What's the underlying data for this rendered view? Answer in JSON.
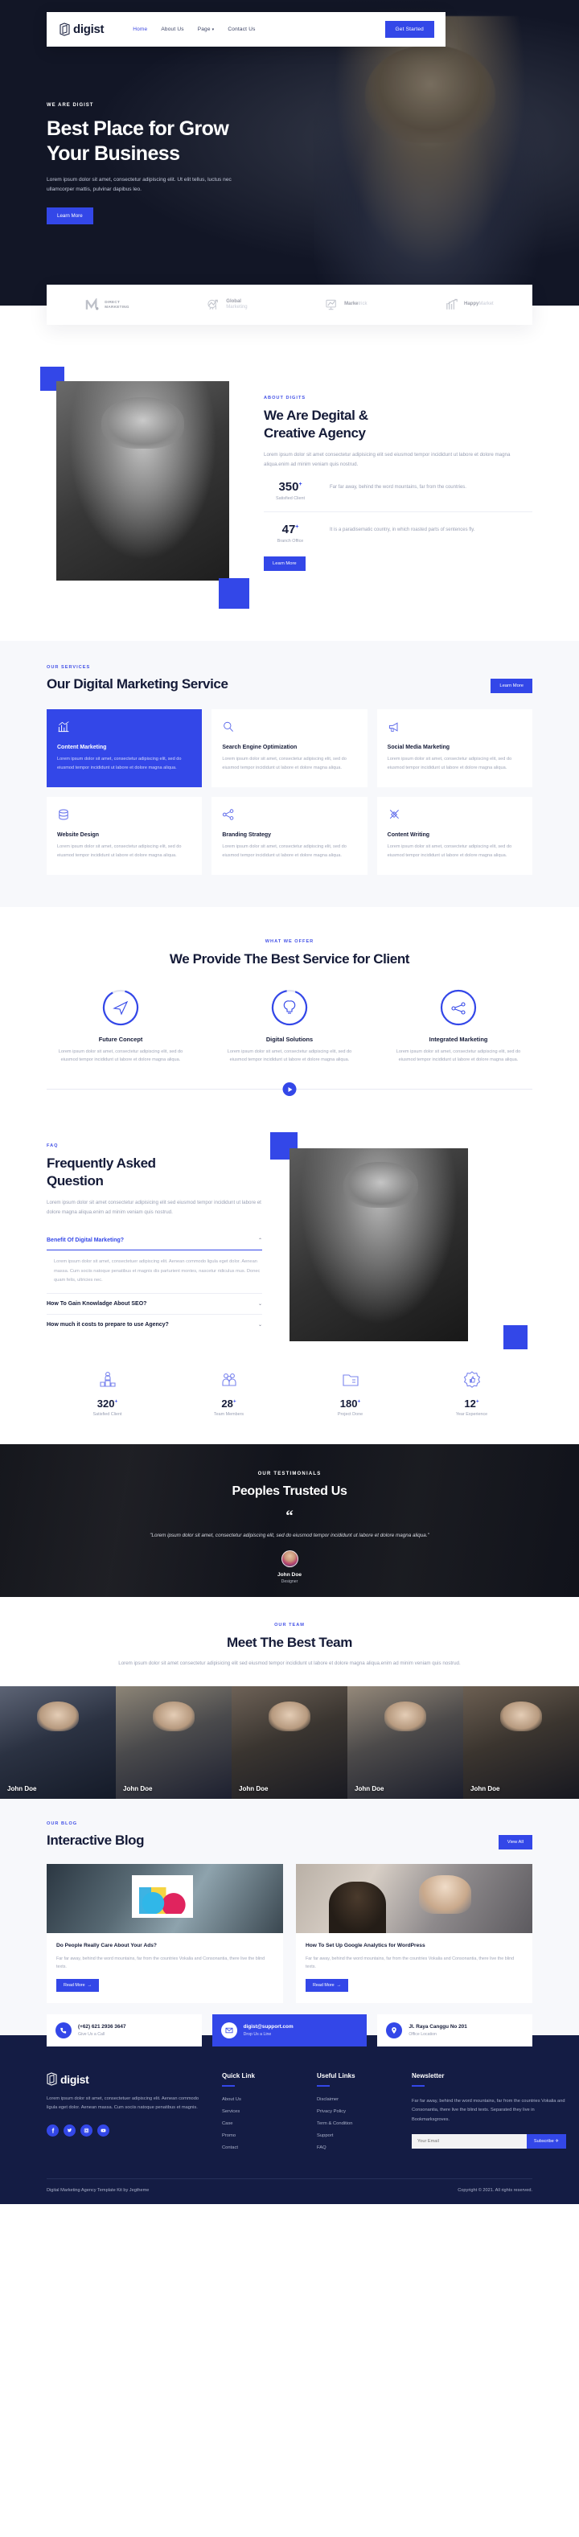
{
  "brand": {
    "name": "digist",
    "logo_icon": "digist-logo-icon"
  },
  "nav": {
    "items": [
      {
        "label": "Home",
        "active": true
      },
      {
        "label": "About Us",
        "active": false
      },
      {
        "label": "Page",
        "active": false,
        "has_caret": true
      },
      {
        "label": "Contact Us",
        "active": false
      }
    ],
    "cta_label": "Get Started"
  },
  "hero": {
    "eyebrow": "WE ARE DIGIST",
    "title_line1": "Best Place for Grow",
    "title_line2": "Your Business",
    "description": "Lorem ipsum dolor sit amet, consectetur adipiscing elit. Ut elit tellus, luctus nec ullamcorper mattis, pulvinar dapibus leo.",
    "cta_label": "Learn More"
  },
  "logos": [
    {
      "name": "DIRECT",
      "name2": "MARKETING",
      "icon": "direct-marketing-logo-icon"
    },
    {
      "name": "Global",
      "name2": "Marketing",
      "icon": "global-marketing-logo-icon"
    },
    {
      "name": "Marke",
      "name2": "trick",
      "icon": "marketrick-logo-icon"
    },
    {
      "name": "Happy",
      "name2": "Market",
      "icon": "happymarket-logo-icon"
    }
  ],
  "about": {
    "eyebrow": "ABOUT DIGITS",
    "title_line1": "We Are Degital &",
    "title_line2": "Creative Agency",
    "description": "Lorem ipsum dolor sit amet consectetur adipisicing elit sed eiusmod tempor incididunt ut labore et dolore magna aliqua.enim ad minim veniam quis nostrud.",
    "stats": [
      {
        "number": "350",
        "plus": "+",
        "label": "Satisfied Client",
        "desc": "Far far away, behind the word mountains, far from the countries."
      },
      {
        "number": "47",
        "plus": "+",
        "label": "Branch Office",
        "desc": "It is a paradisematic country, in which roasted parts of sentences fly."
      }
    ],
    "cta_label": "Learn More"
  },
  "services": {
    "eyebrow": "OUR SERVICES",
    "title": "Our Digital Marketing Service",
    "cta_label": "Learn More",
    "cards": [
      {
        "title": "Content Marketing",
        "desc": "Lorem ipsum dolor sit amet, consectetur adipiscing elit, sed do eiusmod tempor incididunt ut labore et dolore magna aliqua.",
        "icon": "chart-growth-icon",
        "active": true
      },
      {
        "title": "Search Engine Optimization",
        "desc": "Lorem ipsum dolor sit amet, consectetur adipiscing elit, sed do eiusmod tempor incididunt ut labore et dolore magna aliqua.",
        "icon": "magnifier-icon",
        "active": false
      },
      {
        "title": "Social Media Marketing",
        "desc": "Lorem ipsum dolor sit amet, consectetur adipiscing elit, sed do eiusmod tempor incididunt ut labore et dolore magna aliqua.",
        "icon": "megaphone-icon",
        "active": false
      },
      {
        "title": "Website Design",
        "desc": "Lorem ipsum dolor sit amet, consectetur adipiscing elit, sed do eiusmod tempor incididunt ut labore et dolore magna aliqua.",
        "icon": "database-icon",
        "active": false
      },
      {
        "title": "Branding Strategy",
        "desc": "Lorem ipsum dolor sit amet, consectetur adipiscing elit, sed do eiusmod tempor incididunt ut labore et dolore magna aliqua.",
        "icon": "share-nodes-icon",
        "active": false
      },
      {
        "title": "Content Writing",
        "desc": "Lorem ipsum dolor sit amet, consectetur adipiscing elit, sed do eiusmod tempor incididunt ut labore et dolore magna aliqua.",
        "icon": "pencil-cross-icon",
        "active": false
      }
    ]
  },
  "offer": {
    "eyebrow": "WHAT WE OFFER",
    "title": "We Provide The Best Service for Client",
    "items": [
      {
        "title": "Future Concept",
        "desc": "Lorem ipsum dolor sit amet, consectetur adipiscing elit, sed do eiusmod tempor incididunt ut labore et dolore magna aliqua.",
        "icon": "paper-plane-icon",
        "progress": 88
      },
      {
        "title": "Digital Solutions",
        "desc": "Lorem ipsum dolor sit amet, consectetur adipiscing elit, sed do eiusmod tempor incididunt ut labore et dolore magna aliqua.",
        "icon": "lightbulb-icon",
        "progress": 92
      },
      {
        "title": "Integrated Marketing",
        "desc": "Lorem ipsum dolor sit amet, consectetur adipiscing elit, sed do eiusmod tempor incididunt ut labore et dolore magna aliqua.",
        "icon": "share-nodes-icon",
        "progress": 100
      }
    ],
    "play_icon": "play-button-icon"
  },
  "faq": {
    "eyebrow": "FAQ",
    "title_line1": "Frequently Asked",
    "title_line2": "Question",
    "description": "Lorem ipsum dolor sit amet consectetur adipisicing elit sed eiusmod tempor incididunt ut labore et dolore magna aliqua.enim ad minim veniam quis nostrud.",
    "items": [
      {
        "q": "Benefit Of Digital Marketing?",
        "open": true,
        "a": "Lorem ipsum dolor sit amet, consectetuer adipiscing elit. Aenean commodo ligula eget dolor. Aenean massa. Cum sociis natoque penatibus et magnis dis parturient montes, nascetur ridiculus mus. Donec quam felis, ultricies nec."
      },
      {
        "q": "How To Gain Knowladge About SEO?",
        "open": false,
        "a": ""
      },
      {
        "q": "How much it costs to prepare to use Agency?",
        "open": false,
        "a": ""
      }
    ]
  },
  "counters": [
    {
      "number": "320",
      "plus": "+",
      "label": "Satisfied Client",
      "icon": "client-podium-icon"
    },
    {
      "number": "28",
      "plus": "+",
      "label": "Team Members",
      "icon": "team-group-icon"
    },
    {
      "number": "180",
      "plus": "+",
      "label": "Project Done",
      "icon": "folder-icon"
    },
    {
      "number": "12",
      "plus": "+",
      "label": "Year Experience",
      "icon": "award-badge-icon"
    }
  ],
  "testimonial": {
    "eyebrow": "OUR TESTIMONIALS",
    "title": "Peoples Trusted Us",
    "quote_mark": "“",
    "quote": "\"Lorem ipsum dolor sit amet, consectetur adipiscing elit, sed do eiusmod tempor incididunt ut labore et dolore magna aliqua.\"",
    "name": "John Doe",
    "role": "Designer"
  },
  "team": {
    "eyebrow": "OUR TEAM",
    "title": "Meet The Best Team",
    "description": "Lorem ipsum dolor sit amet consectetur adipisicing elit sed eiusmod tempor incididunt ut labore et dolore magna aliqua.enim ad minim veniam quis nostrud.",
    "members": [
      {
        "name": "John Doe"
      },
      {
        "name": "John Doe"
      },
      {
        "name": "John Doe"
      },
      {
        "name": "John Doe"
      },
      {
        "name": "John Doe"
      }
    ]
  },
  "blog": {
    "eyebrow": "OUR BLOG",
    "title": "Interactive Blog",
    "cta_label": "View All",
    "posts": [
      {
        "title": "Do People Really Care About Your Ads?",
        "desc": "Far far away, behind the word mountains, far from the countries Vokalia and Consonantia, there live the blind texts.",
        "cta": "Read More",
        "arrow": "→"
      },
      {
        "title": "How To Set Up Google Analytics for WordPress",
        "desc": "Far far away, behind the word mountains, far from the countries Vokalia and Consonantia, there live the blind texts.",
        "cta": "Read More",
        "arrow": "→"
      }
    ]
  },
  "contact_cards": [
    {
      "value": "(+62) 621 2936 3647",
      "sub": "Give Us a Call",
      "icon": "phone-icon",
      "accent": false
    },
    {
      "value": "digist@support.com",
      "sub": "Drop Us a Line",
      "icon": "envelope-icon",
      "accent": true
    },
    {
      "value": "Jl. Raya Canggu No 201",
      "sub": "Office Location",
      "icon": "location-pin-icon",
      "accent": false
    }
  ],
  "footer": {
    "brand": "digist",
    "about": "Lorem ipsum dolor sit amet, consectetuer adipiscing elit. Aenean commodo ligula eget dolor. Aenean massa. Cum sociis natoque penatibus et magnis.",
    "socials": [
      {
        "name": "facebook-icon",
        "glyph": "f"
      },
      {
        "name": "twitter-icon",
        "glyph": "t"
      },
      {
        "name": "instagram-icon",
        "glyph": "o"
      },
      {
        "name": "youtube-icon",
        "glyph": "▶"
      }
    ],
    "quick_link": {
      "heading": "Quick Link",
      "items": [
        "About Us",
        "Services",
        "Case",
        "Promo",
        "Contact"
      ]
    },
    "useful_links": {
      "heading": "Useful Links",
      "items": [
        "Disclaimer",
        "Privacy Policy",
        "Term & Condition",
        "Support",
        "FAQ"
      ]
    },
    "newsletter": {
      "heading": "Newsletter",
      "text": "Far far away, behind the word mountains, far from the countries Vokalia and Consonantia, there live the blind texts. Separated they live in Bookmarksgroves.",
      "placeholder": "Your Email",
      "button": "Subscribe",
      "button_icon": "✈"
    },
    "credit": "Digital Marketing Agency Template Kit by Jegtheme",
    "copyright": "Copyright © 2021. All rights reserved."
  },
  "colors": {
    "accent": "#3347e8",
    "dark": "#141c44",
    "heading": "#151b38",
    "muted": "#9aa0b4"
  }
}
